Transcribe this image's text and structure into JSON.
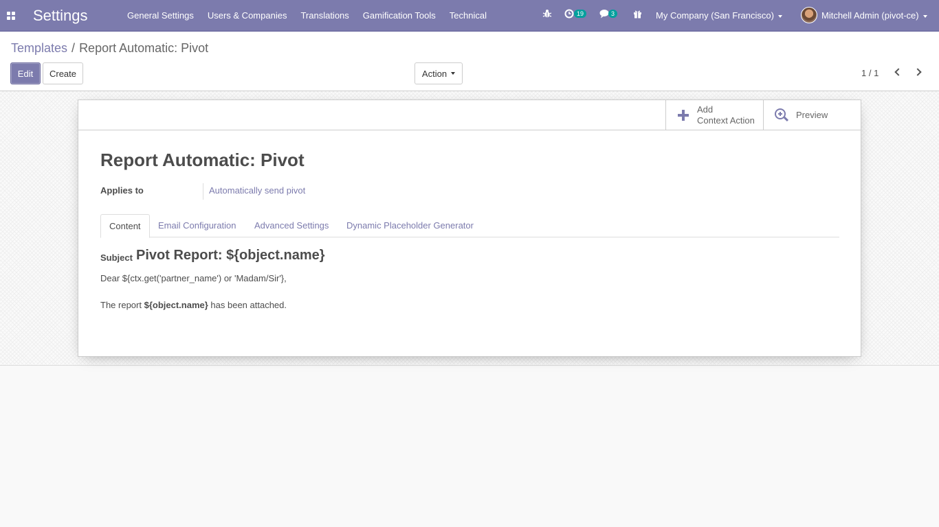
{
  "navbar": {
    "app_title": "Settings",
    "menu": [
      "General Settings",
      "Users & Companies",
      "Translations",
      "Gamification Tools",
      "Technical"
    ],
    "activity_count": "19",
    "messages_count": "3",
    "company": "My Company (San Francisco)",
    "user": "Mitchell Admin (pivot-ce)"
  },
  "breadcrumb": {
    "parent": "Templates",
    "separator": "/",
    "current": "Report Automatic: Pivot"
  },
  "toolbar": {
    "edit_label": "Edit",
    "create_label": "Create",
    "action_label": "Action",
    "pager": "1 / 1"
  },
  "button_box": {
    "context_action_line1": "Add",
    "context_action_line2": "Context Action",
    "preview_label": "Preview"
  },
  "form": {
    "title": "Report Automatic: Pivot",
    "applies_to_label": "Applies to",
    "applies_to_value": "Automatically send pivot",
    "tabs": [
      "Content",
      "Email Configuration",
      "Advanced Settings",
      "Dynamic Placeholder Generator"
    ],
    "active_tab": "Content",
    "subject_label": "Subject",
    "subject_value": "Pivot Report: ${object.name}",
    "body_greeting": "Dear ${ctx.get('partner_name') or 'Madam/Sir'},",
    "body_prefix": "The report ",
    "body_bold": "${object.name}",
    "body_suffix": " has been attached."
  },
  "colors": {
    "brand": "#7c7bad",
    "badge": "#00a09d"
  }
}
